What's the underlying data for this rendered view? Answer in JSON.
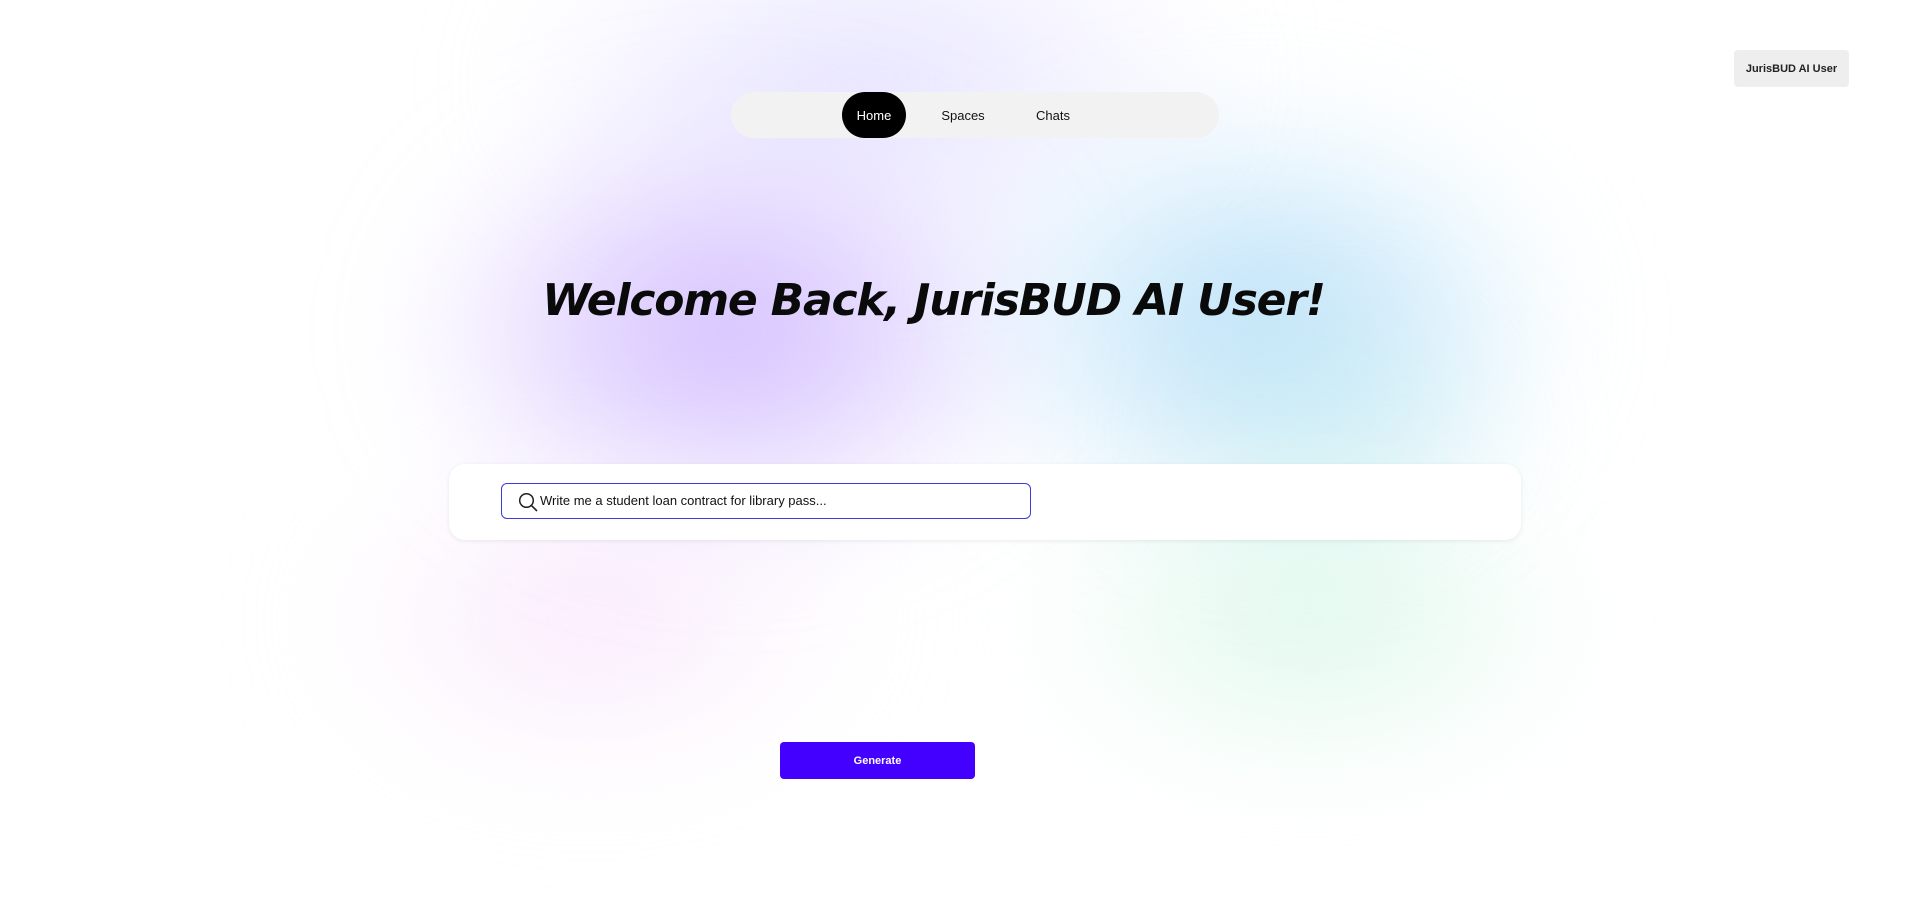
{
  "header": {
    "user_badge": "JurisBUD AI User"
  },
  "nav": {
    "tabs": [
      {
        "label": "Home",
        "active": true
      },
      {
        "label": "Spaces",
        "active": false
      },
      {
        "label": "Chats",
        "active": false
      }
    ]
  },
  "main": {
    "title": "Welcome Back, JurisBUD AI User!",
    "search": {
      "value": "Write me a student loan contract for library pass...",
      "icon": "search-icon"
    },
    "generate_label": "Generate"
  },
  "colors": {
    "accent": "#4400ff",
    "active_tab": "#000000",
    "input_border": "#3b3bd8"
  }
}
